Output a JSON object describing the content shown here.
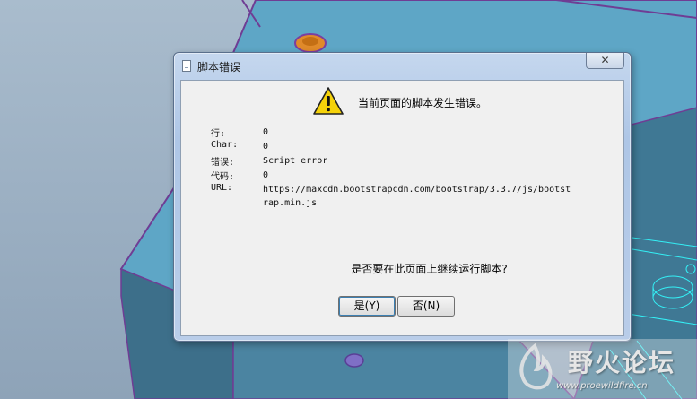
{
  "dialog": {
    "title": "脚本错误",
    "close_label": "✕",
    "message": "当前页面的脚本发生错误。",
    "details": [
      {
        "label": "行:",
        "value": "0"
      },
      {
        "label": "Char:",
        "value": "0"
      },
      {
        "label": "错误:",
        "value": "Script error"
      },
      {
        "label": "代码:",
        "value": "0"
      }
    ],
    "url_label": "URL:",
    "url_value": "https://maxcdn.bootstrapcdn.com/bootstrap/3.3.7/js/bootstrap.min.js",
    "question": "是否要在此页面上继续运行脚本?",
    "yes_label": "是(Y)",
    "no_label": "否(N)"
  },
  "watermark": {
    "text": "野火论坛",
    "url": "www.proewildfire.cn"
  },
  "colors": {
    "viewport_bg": "#9fb4c6",
    "model_face": "#5fa8c8",
    "model_edge": "#7a3fa0",
    "warning_yellow": "#f5d20a"
  }
}
